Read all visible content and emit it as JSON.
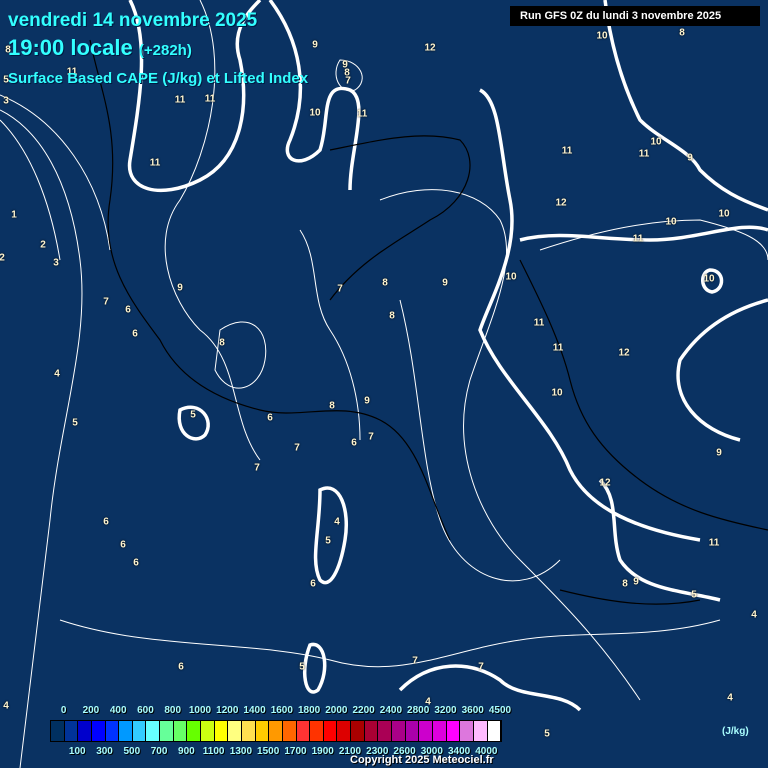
{
  "header": {
    "date": "vendredi 14 novembre 2025",
    "time": "19:00 locale",
    "lead": "(+282h)",
    "product": "Surface Based CAPE (J/kg) et Lifted Index",
    "run": "Run GFS 0Z du lundi 3 novembre 2025"
  },
  "contour_labels": [
    "9",
    "12",
    "10",
    "8",
    "8",
    "11",
    "9",
    "8",
    "7",
    "5",
    "3",
    "11",
    "11",
    "10",
    "11",
    "11",
    "10",
    "11",
    "11",
    "9",
    "12",
    "10",
    "10",
    "11",
    "1",
    "2",
    "2",
    "3",
    "9",
    "7",
    "8",
    "9",
    "10",
    "10",
    "7",
    "6",
    "6",
    "8",
    "8",
    "11",
    "11",
    "12",
    "4",
    "10",
    "5",
    "8",
    "9",
    "5",
    "6",
    "7",
    "6",
    "7",
    "7",
    "9",
    "12",
    "6",
    "4",
    "6",
    "5",
    "11",
    "6",
    "8",
    "9",
    "6",
    "5",
    "4",
    "6",
    "5",
    "7",
    "7",
    "4",
    "4",
    "4",
    "5"
  ],
  "legend": {
    "colors": [
      "#000a3a",
      "#003060",
      "#003399",
      "#0000cc",
      "#0000ff",
      "#0033ff",
      "#0099ff",
      "#33ccff",
      "#66ffff",
      "#66ff99",
      "#66ff66",
      "#66ff00",
      "#ccff11",
      "#ffff00",
      "#ffff80",
      "#ffe050",
      "#ffcc00",
      "#ff9900",
      "#ff6600",
      "#ff3333",
      "#ff3300",
      "#ff0000",
      "#dd0000",
      "#aa0000",
      "#aa0033",
      "#aa0055",
      "#aa0088",
      "#aa00aa",
      "#cc00cc",
      "#dd00dd",
      "#ff00ff",
      "#dd77dd",
      "#ffbbff",
      "#ffffff"
    ],
    "top_labels": [
      "0",
      "200",
      "400",
      "600",
      "800",
      "1000",
      "1200",
      "1400",
      "1600",
      "1800",
      "2000",
      "2200",
      "2400",
      "2800",
      "3200",
      "3600",
      "4500"
    ],
    "bottom_labels": [
      "100",
      "300",
      "500",
      "700",
      "900",
      "1100",
      "1300",
      "1500",
      "1700",
      "1900",
      "2100",
      "2300",
      "2600",
      "3000",
      "3400",
      "4000"
    ],
    "unit": "(J/kg)"
  },
  "copyright": "Copyright 2025 Meteociel.fr"
}
